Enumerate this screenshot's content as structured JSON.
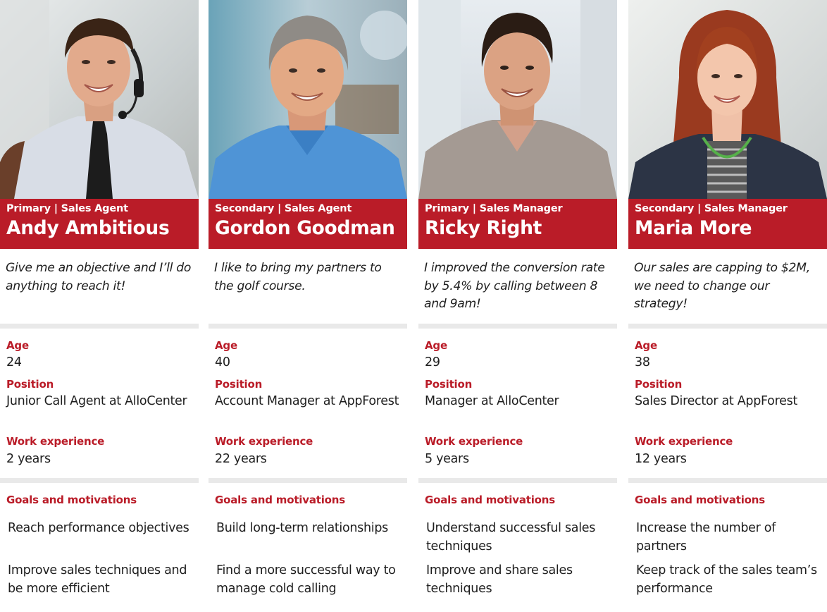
{
  "labels": {
    "age": "Age",
    "position": "Position",
    "work_experience": "Work experience",
    "goals": "Goals and motivations"
  },
  "personas": [
    {
      "role": "Primary | Sales Agent",
      "name": "Andy Ambitious",
      "quote": "Give me an objective and I’ll do anything to reach it!",
      "age": "24",
      "position": "Junior Call Agent at AlloCenter",
      "experience": "2 years",
      "goals": [
        "Reach performance objectives",
        "Improve sales techniques and be more efficient"
      ],
      "photo": "man-with-headset-and-tie"
    },
    {
      "role": "Secondary | Sales Agent",
      "name": "Gordon Goodman",
      "quote": "I like to bring my partners to the golf course.",
      "age": "40",
      "position": "Account Manager at AppForest",
      "experience": "22 years",
      "goals": [
        "Build long-term relationships",
        "Find a more successful way to manage cold calling"
      ],
      "photo": "gray-haired-man-blue-shirt"
    },
    {
      "role": "Primary | Sales Manager",
      "name": "Ricky Right",
      "quote": "I improved the conversion rate by 5.4% by calling between 8 and 9am!",
      "age": "29",
      "position": "Manager at AlloCenter",
      "experience": "5 years",
      "goals": [
        "Understand successful sales techniques",
        "Improve and share sales techniques"
      ],
      "photo": "dark-haired-man-casual-shirt"
    },
    {
      "role": "Secondary | Sales Manager",
      "name": "Maria More",
      "quote": "Our sales are capping to $2M, we need to change our strategy!",
      "age": "38",
      "position": "Sales Director at AppForest",
      "experience": "12 years",
      "goals": [
        "Increase the number of partners",
        "Keep track of the sales team’s performance"
      ],
      "photo": "red-haired-woman-blazer"
    }
  ],
  "colors": {
    "accent": "#ba1c28",
    "divider": "#e9e9e9",
    "text": "#1e1e1e"
  }
}
